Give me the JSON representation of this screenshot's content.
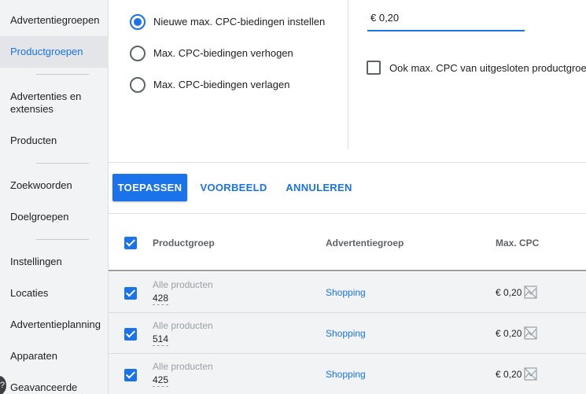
{
  "sidebar": {
    "items": [
      {
        "label": "Advertentiegroepen"
      },
      {
        "label": "Productgroepen"
      },
      {
        "label": "Advertenties en extensies"
      },
      {
        "label": "Producten"
      },
      {
        "label": "Zoekwoorden"
      },
      {
        "label": "Doelgroepen"
      },
      {
        "label": "Instellingen"
      },
      {
        "label": "Locaties"
      },
      {
        "label": "Advertentieplanning"
      },
      {
        "label": "Apparaten"
      },
      {
        "label": "Geavanceerde"
      }
    ],
    "active_index": 1
  },
  "bid_options": {
    "options": [
      {
        "label": "Nieuwe max. CPC-biedingen instellen",
        "selected": true
      },
      {
        "label": "Max. CPC-biedingen verhogen",
        "selected": false
      },
      {
        "label": "Max. CPC-biedingen verlagen",
        "selected": false
      }
    ],
    "amount_value": "€ 0,20",
    "excluded_checkbox_label": "Ook max. CPC van uitgesloten productgroep"
  },
  "actions": {
    "apply_label": "TOEPASSEN",
    "preview_label": "VOORBEELD",
    "cancel_label": "ANNULEREN"
  },
  "table": {
    "headers": {
      "productgroep": "Productgroep",
      "advertentiegroep": "Advertentiegroep",
      "max_cpc": "Max. CPC"
    },
    "rows": [
      {
        "group_label": "Alle producten",
        "group_id": "428",
        "ad_group": "Shopping",
        "max_cpc": "€ 0,20"
      },
      {
        "group_label": "Alle producten",
        "group_id": "514",
        "ad_group": "Shopping",
        "max_cpc": "€ 0,20"
      },
      {
        "group_label": "Alle producten",
        "group_id": "425",
        "ad_group": "Shopping",
        "max_cpc": "€ 0,20"
      }
    ]
  },
  "colors": {
    "accent": "#1a73e8",
    "sidebar_bg": "#f1f3f4",
    "row_bg": "#f1f3f4"
  }
}
